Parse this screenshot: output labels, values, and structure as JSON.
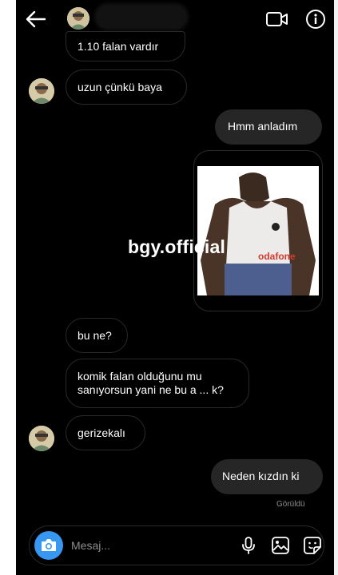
{
  "header": {
    "back_icon": "arrow-left-icon",
    "video_icon": "video-camera-icon",
    "info_icon": "info-icon"
  },
  "messages": [
    {
      "id": "m1",
      "side": "incoming",
      "text": "1.10 falan vardır"
    },
    {
      "id": "m2",
      "side": "incoming",
      "text": "uzun çünkü baya"
    },
    {
      "id": "m3",
      "side": "outgoing",
      "text": "Hmm anladım"
    },
    {
      "id": "m5",
      "side": "incoming",
      "text": "bu ne?"
    },
    {
      "id": "m6",
      "side": "incoming",
      "lines": [
        "komik falan olduğunu mu",
        "sanıyorsun yani ne bu a ... k?"
      ]
    },
    {
      "id": "m7",
      "side": "incoming",
      "text": "gerizekalı"
    },
    {
      "id": "m8",
      "side": "outgoing",
      "text": "Neden kızdın ki"
    }
  ],
  "photo": {
    "shirt_text": "odafone"
  },
  "watermark": "bgy.official",
  "seen_status": "Görüldü",
  "composer": {
    "placeholder": "Mesaj...",
    "camera_icon": "camera-icon",
    "mic_icon": "microphone-icon",
    "gallery_icon": "image-gallery-icon",
    "sticker_icon": "sticker-icon"
  },
  "colors": {
    "background": "#000000",
    "outgoing_bubble": "#262626",
    "incoming_border": "#2a2a2a",
    "accent": "#3897f0",
    "text": "#ffffff",
    "muted": "#8e8e8e"
  }
}
